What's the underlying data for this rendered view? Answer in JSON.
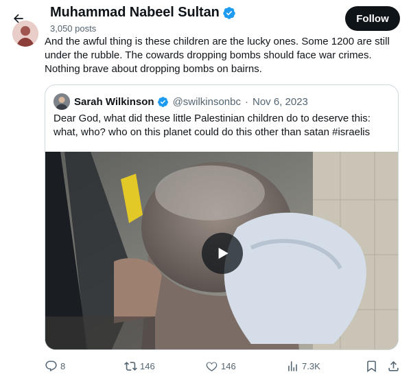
{
  "header": {
    "name": "Muhammad Nabeel Sultan",
    "posts_count": "3,050 posts",
    "follow_label": "Follow"
  },
  "tweet": {
    "text": "And the awful thing is these children are the lucky ones. Some 1200 are still under the rubble. The cowards dropping bombs should face war crimes. Nothing brave about dropping bombs on bairns."
  },
  "quote": {
    "author_name": "Sarah Wilkinson",
    "handle": "@swilkinsonbc",
    "separator": "·",
    "date": "Nov 6, 2023",
    "text": "Dear God, what did these little Palestinian children do to deserve this: what, who? who on this planet could do this other than satan #israelis"
  },
  "actions": {
    "replies": "8",
    "reposts": "146",
    "likes": "146",
    "views": "7.3K"
  },
  "colors": {
    "verified": "#1d9bf0",
    "text_primary": "#0f1419",
    "text_secondary": "#536471",
    "border": "#cfd9de"
  },
  "icons": [
    "back-arrow-icon",
    "verified-badge-icon",
    "play-icon",
    "reply-icon",
    "repost-icon",
    "like-icon",
    "views-icon",
    "bookmark-icon",
    "share-icon"
  ]
}
